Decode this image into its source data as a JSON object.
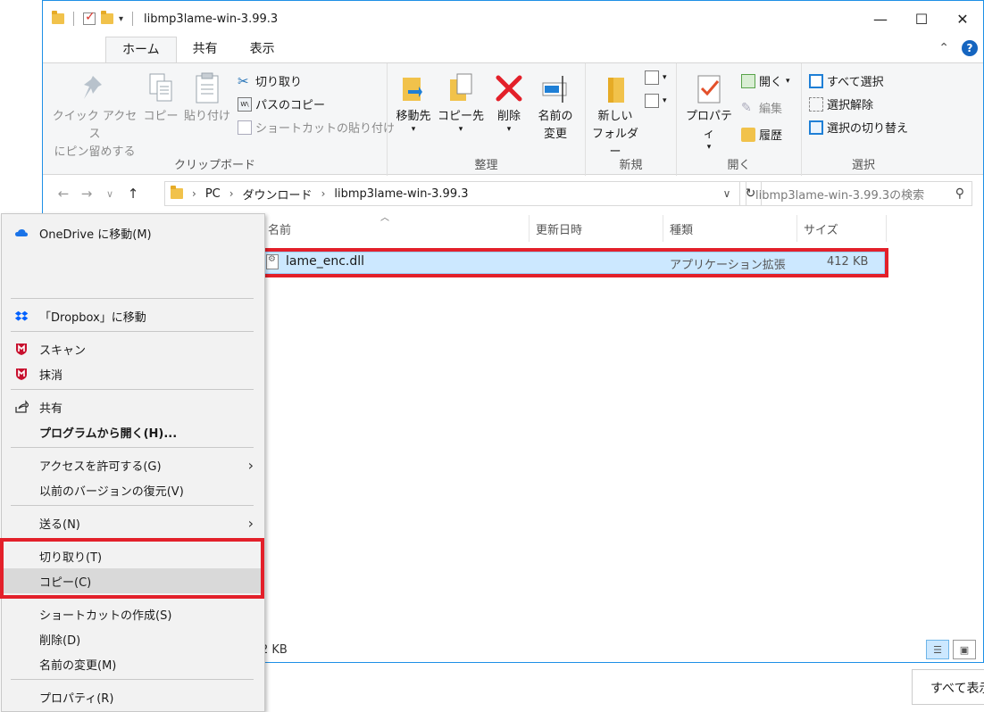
{
  "window": {
    "title": "libmp3lame-win-3.99.3",
    "controls": {
      "minimize": "—",
      "maximize": "☐",
      "close": "✕"
    }
  },
  "tabs": [
    "ホーム",
    "共有",
    "表示"
  ],
  "ribbon": {
    "clipboard": {
      "pin_line1": "クイック アクセス",
      "pin_line2": "にピン留めする",
      "copy": "コピー",
      "paste": "貼り付け",
      "cut": "切り取り",
      "copy_path": "パスのコピー",
      "paste_shortcut": "ショートカットの貼り付け",
      "label": "クリップボード"
    },
    "organize": {
      "move_to": "移動先",
      "copy_to": "コピー先",
      "delete": "削除",
      "rename_line1": "名前の",
      "rename_line2": "変更",
      "label": "整理"
    },
    "new": {
      "new_folder_line1": "新しい",
      "new_folder_line2": "フォルダー",
      "label": "新規"
    },
    "open": {
      "properties": "プロパティ",
      "open": "開く",
      "edit": "編集",
      "history": "履歴",
      "label": "開く"
    },
    "select": {
      "select_all": "すべて選択",
      "select_none": "選択解除",
      "invert": "選択の切り替え",
      "label": "選択"
    }
  },
  "address": {
    "crumbs": [
      "PC",
      "ダウンロード",
      "libmp3lame-win-3.99.3"
    ],
    "search_placeholder": "libmp3lame-win-3.99.3の検索"
  },
  "columns": [
    "名前",
    "更新日時",
    "種類",
    "サイズ"
  ],
  "files": [
    {
      "name": "lame_enc.dll",
      "modified": "",
      "type": "アプリケーション拡張",
      "size": "412 KB"
    }
  ],
  "status_text": "2 KB",
  "under_button": "すべて表示",
  "context_menu": {
    "onedrive": "OneDrive に移動(M)",
    "dropbox": "「Dropbox」に移動",
    "scan": "スキャン",
    "shred": "抹消",
    "share": "共有",
    "open_with": "プログラムから開く(H)...",
    "give_access": "アクセスを許可する(G)",
    "restore": "以前のバージョンの復元(V)",
    "send_to": "送る(N)",
    "cut": "切り取り(T)",
    "copy": "コピー(C)",
    "create_shortcut": "ショートカットの作成(S)",
    "delete": "削除(D)",
    "rename": "名前の変更(M)",
    "properties": "プロパティ(R)"
  },
  "colors": {
    "highlight_red": "#e3202a",
    "selection": "#cce8ff",
    "accent": "#1e90e6"
  }
}
